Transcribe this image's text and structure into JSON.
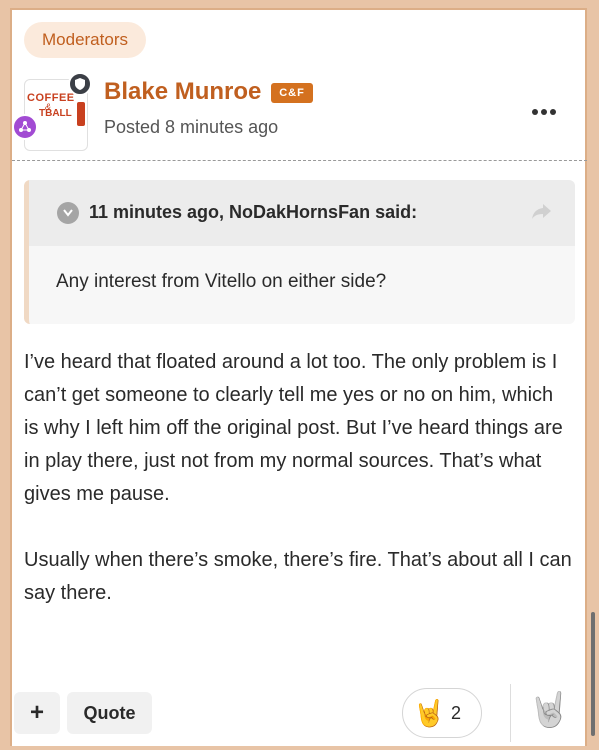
{
  "badge": {
    "label": "Moderators"
  },
  "post": {
    "author": "Blake Munroe",
    "rank_badge": "C&F",
    "posted": "Posted 8 minutes ago",
    "avatar": {
      "logo_top": "COFFEE",
      "logo_amp": "&",
      "logo_bottom": "TBALL"
    }
  },
  "quote": {
    "citation": "11 minutes ago, NoDakHornsFan said:",
    "text": "Any interest from Vitello on either side?"
  },
  "body": {
    "p1": "I’ve heard that floated around a lot too. The only problem is I can’t get someone to clearly tell me yes or no on him, which is why I left him off the original post. But I’ve heard things are in play there, just not from my normal sources. That’s what gives me pause.",
    "p2": "Usually when there’s smoke, there’s fire. That’s about all I can say there."
  },
  "actions": {
    "plus_label": "+",
    "quote_label": "Quote",
    "reaction_emoji": "🤘",
    "reaction_count": "2",
    "react_emoji": "🤘"
  },
  "colors": {
    "accent": "#c05f1f",
    "badge_bg": "#fbeadc",
    "page_bg": "#e8c4a6"
  }
}
